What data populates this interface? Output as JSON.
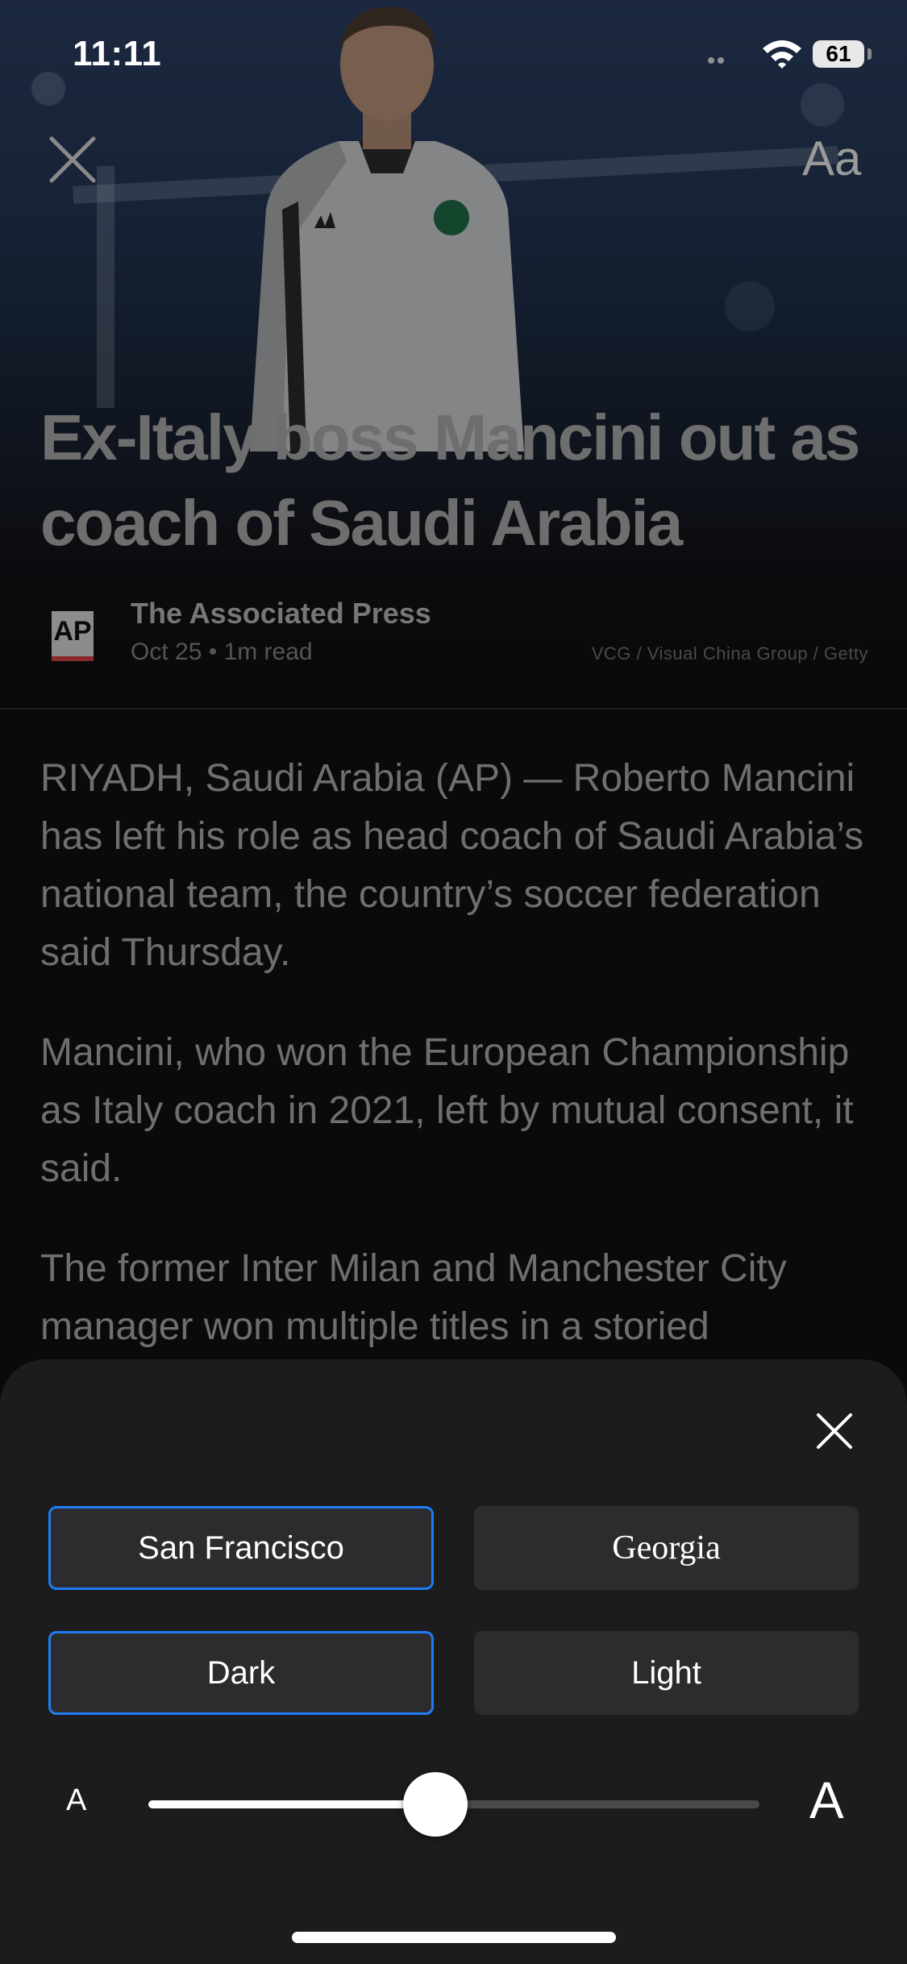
{
  "status_bar": {
    "time": "11:11",
    "battery": "61"
  },
  "hero": {
    "close_icon": "close-icon",
    "text_size_label": "Aa",
    "headline": "Ex-Italy boss Mancini out as coach of Saudi Arabia"
  },
  "publisher": {
    "logo_text": "AP",
    "name": "The Associated Press",
    "meta": "Oct 25 • 1m read",
    "photo_credit": "VCG / Visual China Group / Getty"
  },
  "article": {
    "paragraphs": [
      "RIYADH, Saudi Arabia (AP) — Roberto Mancini has left his role as head coach of Saudi Arabia’s national team, the country’s soccer federation said Thursday.",
      "Mancini, who won the European Championship as Italy coach in 2021, left by mutual consent, it said.",
      "The former Inter Milan and Manchester City manager won multiple titles in a storied"
    ]
  },
  "text_settings": {
    "close_icon": "close-icon",
    "fonts": [
      {
        "label": "San Francisco",
        "selected": true
      },
      {
        "label": "Georgia",
        "selected": false
      }
    ],
    "themes": [
      {
        "label": "Dark",
        "selected": true
      },
      {
        "label": "Light",
        "selected": false
      }
    ],
    "size_small_label": "A",
    "size_large_label": "A",
    "text_size_level": 0.47
  },
  "colors": {
    "accent": "#1f7cf5",
    "sheet_background": "#1c1c1e",
    "button_background": "#2c2c2e"
  }
}
